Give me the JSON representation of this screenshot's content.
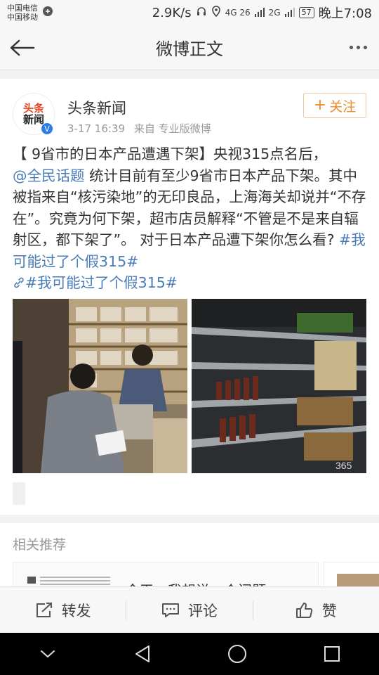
{
  "status_bar": {
    "carrier1": "中国电信",
    "carrier2": "中国移动",
    "speed": "2.9K/s",
    "signal1": "4G 26",
    "signal2": "2G",
    "battery": "57",
    "time": "晚上7:08"
  },
  "nav": {
    "back_icon": "back-arrow-icon",
    "title": "微博正文",
    "more_icon": "more-dots-icon"
  },
  "post": {
    "avatar_line1": "头条",
    "avatar_line2": "新闻",
    "verified_mark": "V",
    "author": "头条新闻",
    "date": "3-17 16:39",
    "source": "来自 专业版微博",
    "follow_label": "关注",
    "text_1": "【 9省市的日本产品遭遇下架】央视315点名后，",
    "mention": "@全民话题",
    "text_2": " 统计目前有至少9省市日本产品下架。其中被指来自“核污染地”的无印良品，上海海关却说并“不存在”。究竟为何下架，超市店员解释“不管是不是来自辐射区，都下架了”。 对于日本产品遭下架你怎么看? ",
    "hashtag_1": "#我可能过了个假315#",
    "hashtag_2": "#我可能过了个假315#",
    "image2_watermark": "365"
  },
  "related": {
    "title": "相关推荐",
    "card1_text": "今天，我想说一个问题"
  },
  "actions": {
    "repost_label": "转发",
    "comment_label": "评论",
    "like_label": "赞"
  }
}
